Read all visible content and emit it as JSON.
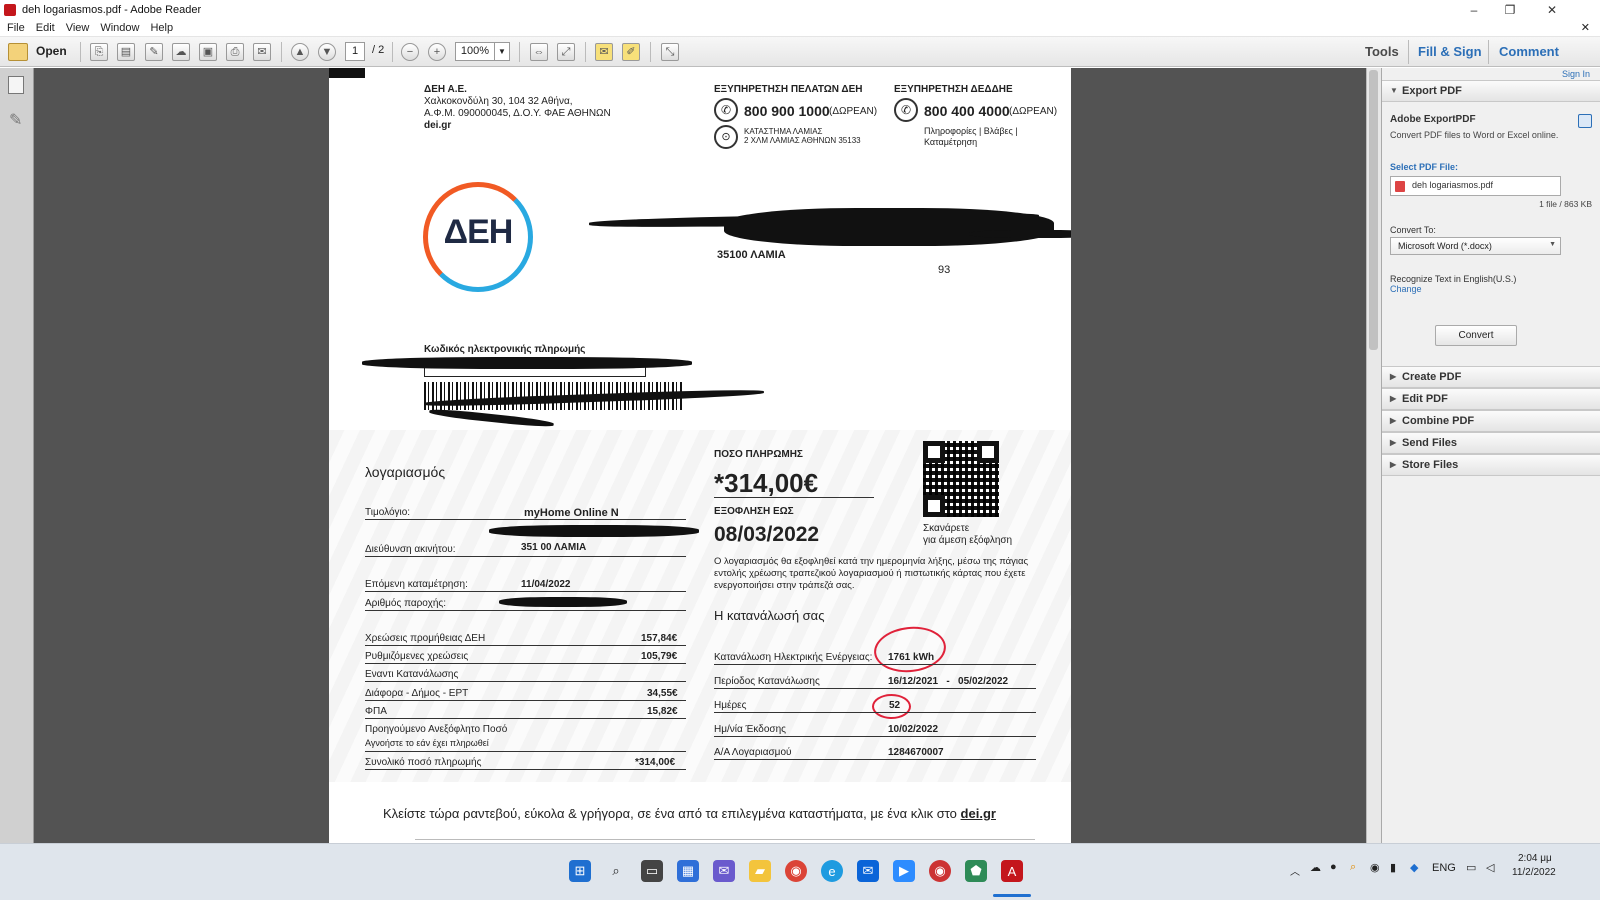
{
  "window": {
    "title": "deh logariasmos.pdf - Adobe Reader",
    "controls": [
      "–",
      "❐",
      "✕"
    ]
  },
  "menu": {
    "items": [
      "File",
      "Edit",
      "View",
      "Window",
      "Help"
    ],
    "close": "✕"
  },
  "toolbar": {
    "open": "Open",
    "page_current": "1",
    "page_total": "/ 2",
    "zoom": "100%",
    "tools": "Tools",
    "fill_sign": "Fill & Sign",
    "comment": "Comment"
  },
  "panel": {
    "sign_in": "Sign In",
    "export_header": "Export PDF",
    "export_title": "Adobe ExportPDF",
    "export_desc": "Convert PDF files to Word or Excel online.",
    "select_label": "Select PDF File:",
    "file_name": "deh logariasmos.pdf",
    "file_count": "1 file / 863 KB",
    "convert_to": "Convert To:",
    "format": "Microsoft Word (*.docx)",
    "recognize": "Recognize Text in English(U.S.)",
    "change": "Change",
    "convert_button": "Convert",
    "sections": [
      "Create PDF",
      "Edit PDF",
      "Combine PDF",
      "Send Files",
      "Store Files"
    ]
  },
  "bill": {
    "company": "ΔΕΗ Α.Ε.",
    "address1": "Χαλκοκονδύλη 30, 104 32 Αθήνα,",
    "address2": "Α.Φ.Μ. 090000045, Δ.Ο.Υ. ΦΑΕ ΑΘΗΝΩΝ",
    "website": "dei.gr",
    "service1_title": "ΕΞΥΠΗΡΕΤΗΣΗ ΠΕΛΑΤΩΝ ΔΕΗ",
    "service1_phone": "800 900 1000",
    "service1_free": "(ΔΩΡΕΑΝ)",
    "store1": "ΚΑΤΑΣΤΗΜΑ ΛΑΜΙΑΣ",
    "store2": "2 ΧΛΜ ΛΑΜΙΑΣ ΑΘΗΝΩΝ 35133",
    "service2_title": "ΕΞΥΠΗΡΕΤΗΣΗ ΔΕΔΔΗΕ",
    "service2_phone": "800 400 4000",
    "service2_free": "(ΔΩΡΕΑΝ)",
    "service2_info1": "Πληροφορίες | Βλάβες |",
    "service2_info2": "Καταμέτρηση",
    "logo_text": "ΔΕΗ",
    "recipient_city": "35100 ΛΑΜΙΑ",
    "recipient_no": "93",
    "epay_label": "Κωδικός ηλεκτρονικής πληρωμής",
    "section_title": "λογαριασμός",
    "tariff_label": "Τιμολόγιο:",
    "tariff_value": "myHome Online N",
    "address_label": "Διεύθυνση ακινήτου:",
    "address_value": "351 00 ΛΑΜΙΑ",
    "next_reading_label": "Επόμενη καταμέτρηση:",
    "next_reading_value": "11/04/2022",
    "supply_label": "Αριθμός παροχής:",
    "charges": [
      {
        "label": "Χρεώσεις προμήθειας ΔΕΗ",
        "value": "157,84€"
      },
      {
        "label": "Ρυθμιζόμενες χρεώσεις",
        "value": "105,79€"
      },
      {
        "label": "Εναντι Κατανάλωσης",
        "value": ""
      },
      {
        "label": "Διάφορα - Δήμος - ΕΡΤ",
        "value": "34,55€"
      },
      {
        "label": "ΦΠΑ",
        "value": "15,82€"
      }
    ],
    "prev_label": "Προηγούμενο Ανεξόφλητο Ποσό",
    "prev_note": "Αγνοήστε το εάν έχει πληρωθεί",
    "total_label": "Συνολικό ποσό πληρωμής",
    "total_value": "*314,00€",
    "amount_label": "ΠΟΣΟ ΠΛΗΡΩΜΗΣ",
    "amount_value": "*314,00€",
    "due_label": "ΕΞΟΦΛΗΣΗ ΕΩΣ",
    "due_value": "08/03/2022",
    "qr_note1": "Σκανάρετε",
    "qr_note2": "για άμεση εξόφληση",
    "direct_debit": "Ο λογαριασμός θα εξοφληθεί κατά την ημερομηνία λήξης, μέσω της πάγιας εντολής χρέωσης τραπεζικού λογαριασμού ή πιστωτικής κάρτας που έχετε ενεργοποιήσει στην τράπεζά σας.",
    "consumption_title": "Η κατανάλωσή σας",
    "consumption_label": "Κατανάλωση Ηλεκτρικής Ενέργειας:",
    "consumption_value": "1761 kWh",
    "period_label": "Περίοδος Κατανάλωσης",
    "period_value": "16/12/2021   -   05/02/2022",
    "days_label": "Ημέρες",
    "days_value": "52",
    "issue_label": "Ημ/νία Έκδοσης",
    "issue_value": "10/02/2022",
    "account_label": "Α/Α Λογαριασμού",
    "account_value": "1284670007",
    "footer": "Κλείστε τώρα ραντεβού, εύκολα & γρήγορα, σε ένα από τα επιλεγμένα καταστήματα, με ένα κλικ στο",
    "footer_link": "dei.gr"
  },
  "system": {
    "lang": "ENG",
    "time": "2:04 μμ",
    "date": "11/2/2022"
  },
  "colors": {
    "accent_blue": "#2c6fb7",
    "annotation_red": "#e0223a",
    "logo_orange": "#f15a24",
    "logo_blue": "#29a9e1"
  }
}
